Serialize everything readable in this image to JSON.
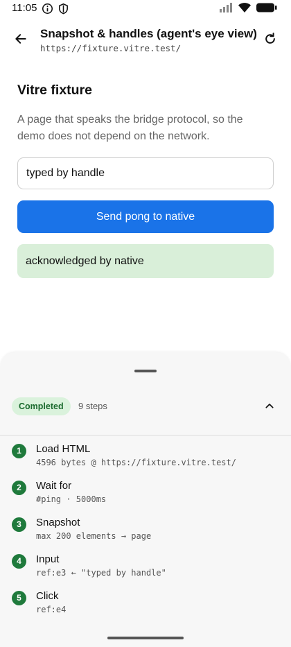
{
  "status_bar": {
    "time": "11:05",
    "left_icons": [
      "info-icon",
      "shield-icon"
    ],
    "right_icons": [
      "cell-signal-icon",
      "wifi-icon",
      "battery-icon"
    ]
  },
  "app_bar": {
    "back_icon": "arrow-left-icon",
    "title": "Snapshot & handles (agent's eye view)",
    "url": "https://fixture.vitre.test/",
    "reload_icon": "refresh-icon"
  },
  "web_page": {
    "title": "Vitre fixture",
    "description": "A page that speaks the bridge protocol, so the demo does not depend on the network.",
    "input_value": "typed by handle",
    "button_label": "Send pong to native",
    "ack_text": "acknowledged by native"
  },
  "sheet": {
    "status": "Completed",
    "steps_count": "9 steps",
    "collapse_icon": "chevron-up-icon",
    "steps": [
      {
        "num": "1",
        "title": "Load HTML",
        "detail": "4596 bytes @ https://fixture.vitre.test/"
      },
      {
        "num": "2",
        "title": "Wait for",
        "detail": "#ping · 5000ms"
      },
      {
        "num": "3",
        "title": "Snapshot",
        "detail": "max 200 elements → page"
      },
      {
        "num": "4",
        "title": "Input",
        "detail": "ref:e3 ← \"typed by handle\""
      },
      {
        "num": "5",
        "title": "Click",
        "detail": "ref:e4"
      }
    ]
  },
  "colors": {
    "primary": "#1a73e8",
    "ack_background": "#d9efd9",
    "chip_background": "#daf2dc",
    "chip_text": "#1b6b2e",
    "step_badge": "#1f7a3c"
  }
}
